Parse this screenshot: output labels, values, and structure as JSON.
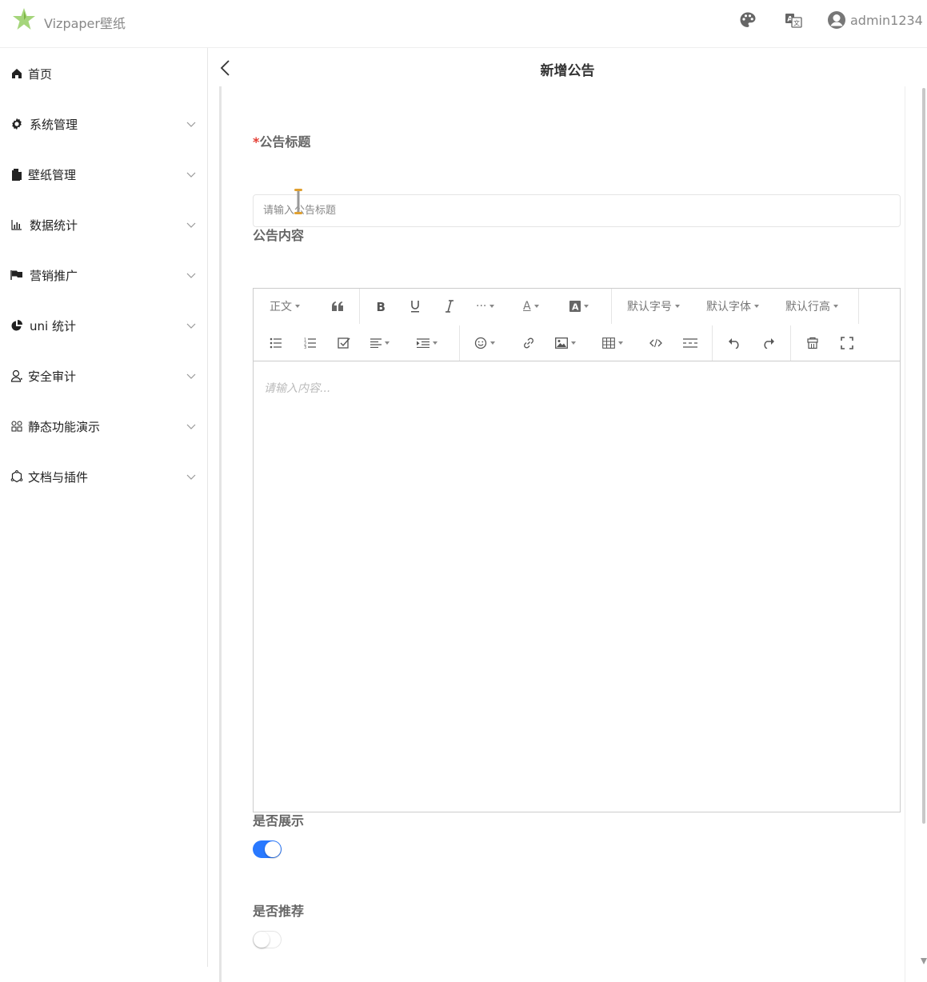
{
  "header": {
    "app_title": "Vizpaper壁纸",
    "username": "admin1234",
    "icons": [
      "star-logo",
      "palette-icon",
      "translate-icon",
      "user-icon"
    ]
  },
  "sidebar": {
    "items": [
      {
        "label": "首页",
        "icon": "home-icon",
        "has_arrow": false
      },
      {
        "label": "系统管理",
        "icon": "gear-icon",
        "has_arrow": true
      },
      {
        "label": "壁纸管理",
        "icon": "files-icon",
        "has_arrow": true
      },
      {
        "label": "数据统计",
        "icon": "bar-chart-icon",
        "has_arrow": true
      },
      {
        "label": "营销推广",
        "icon": "flag-icon",
        "has_arrow": true
      },
      {
        "label": "uni 统计",
        "icon": "pie-chart-icon",
        "has_arrow": true
      },
      {
        "label": "安全审计",
        "icon": "person-icon",
        "has_arrow": true
      },
      {
        "label": "静态功能演示",
        "icon": "grid-icon",
        "has_arrow": true
      },
      {
        "label": "文档与插件",
        "icon": "plugin-icon",
        "has_arrow": true
      }
    ]
  },
  "page": {
    "title": "新增公告"
  },
  "form": {
    "title_required_mark": "*",
    "title_label": "公告标题",
    "title_placeholder": "请输入公告标题",
    "content_label": "公告内容",
    "content_placeholder": "请输入内容...",
    "show_label": "是否展示",
    "show_value": true,
    "recommend_label": "是否推荐",
    "recommend_value": false
  },
  "editor_toolbar": {
    "heading": "正文",
    "font_size": "默认字号",
    "font_family": "默认字体",
    "line_height": "默认行高",
    "more": "···",
    "font_color": "A"
  },
  "colors": {
    "accent": "#2979ff",
    "required": "#e43d33",
    "logo": "#8bc34a"
  }
}
